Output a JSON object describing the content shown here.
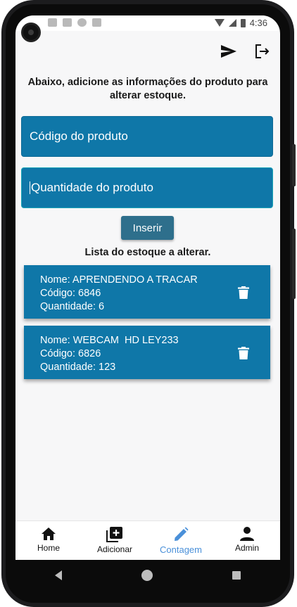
{
  "status_bar": {
    "time": "4:36"
  },
  "header": {
    "instruction": "Abaixo, adicione as informações do produto para alterar estoque."
  },
  "form": {
    "code_placeholder": "Código do produto",
    "quantity_placeholder": "Quantidade do produto",
    "insert_label": "Inserir"
  },
  "list": {
    "title": "Lista do estoque a alterar.",
    "items": [
      {
        "name": "Nome: APRENDENDO A TRACAR",
        "code": "Código: 6846",
        "quantity": "Quantidade: 6"
      },
      {
        "name": "Nome: WEBCAM  HD LEY233",
        "code": "Código: 6826",
        "quantity": "Quantidade: 123"
      }
    ]
  },
  "bottom_nav": {
    "items": [
      {
        "label": "Home",
        "icon": "home-icon"
      },
      {
        "label": "Adicionar",
        "icon": "add-box-icon"
      },
      {
        "label": "Contagem",
        "icon": "pencil-icon",
        "active": true
      },
      {
        "label": "Admin",
        "icon": "person-icon"
      }
    ]
  },
  "colors": {
    "primary": "#0f77a8",
    "active_nav": "#4a90d9",
    "button": "#2e6f8c"
  }
}
